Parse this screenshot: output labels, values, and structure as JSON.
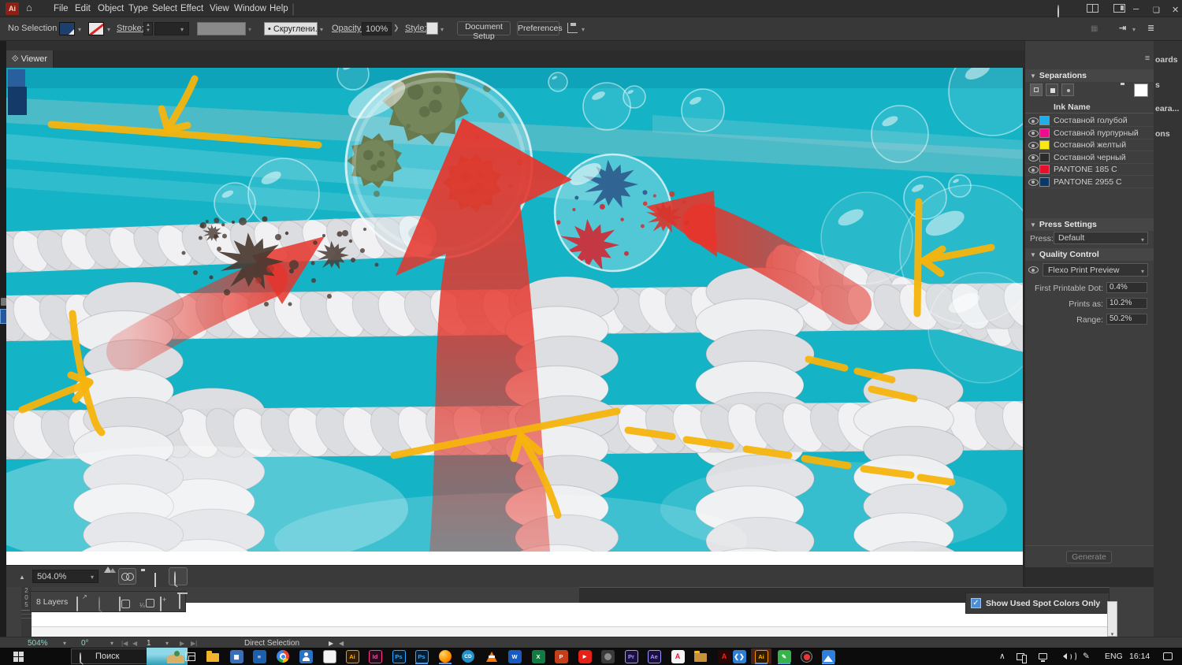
{
  "menubar": {
    "items": [
      "File",
      "Edit",
      "Object",
      "Type",
      "Select",
      "Effect",
      "View",
      "Window",
      "Help"
    ]
  },
  "controlbar": {
    "selection_status": "No Selection",
    "stroke_label": "Stroke:",
    "brush_value": "Скруглени...",
    "opacity_label": "Opacity:",
    "opacity_value": "100%",
    "style_label": "Style:",
    "document_setup_label": "Document Setup",
    "preferences_label": "Preferences"
  },
  "viewer_tab": {
    "label": "Viewer"
  },
  "separations": {
    "title": "Separations",
    "ink_name_header": "Ink Name",
    "inks": [
      {
        "name": "Составной голубой",
        "color": "#1FAEE9"
      },
      {
        "name": "Составной пурпурный",
        "color": "#EC0C8D"
      },
      {
        "name": "Составной желтый",
        "color": "#F9E814"
      },
      {
        "name": "Составной черный",
        "color": "#2D2A2B"
      },
      {
        "name": "PANTONE 185 C",
        "color": "#E8112D"
      },
      {
        "name": "PANTONE 2955 C",
        "color": "#0C3866"
      }
    ]
  },
  "press": {
    "title": "Press Settings",
    "label": "Press:",
    "value": "Default"
  },
  "quality": {
    "title": "Quality Control",
    "preview_mode": "Flexo Print Preview",
    "first_dot_label": "First Printable Dot:",
    "first_dot_value": "0.4%",
    "prints_as_label": "Prints as:",
    "prints_as_value": "10.2%",
    "range_label": "Range:",
    "range_value": "50.2%"
  },
  "generate": {
    "label": "Generate"
  },
  "spot_panel": {
    "label": "Show Used Spot Colors Only",
    "checked": true
  },
  "viewer_toolbar": {
    "zoom_value": "504.0%"
  },
  "layers_bar": {
    "label": "8 Layers"
  },
  "ruler": {
    "digits": [
      "2",
      "0",
      "5"
    ]
  },
  "status_bar": {
    "zoom": "504%",
    "rotation": "0°",
    "artboard_number": "1",
    "tool_name": "Direct Selection"
  },
  "dock_tabs": [
    "oards",
    "s",
    "eara...",
    "ons"
  ],
  "taskbar": {
    "search_text": "Поиск",
    "language": "ENG",
    "time": "16:14",
    "icons": [
      "start",
      "search",
      "weather-widget",
      "task-view",
      "file-explorer",
      "calculator",
      "journal",
      "chrome",
      "contacts",
      "notepad",
      "illustrator",
      "indesign",
      "photoshop",
      "photoshop-2",
      "firefox",
      "coreldraw",
      "vlc",
      "word",
      "excel",
      "powerpoint",
      "youtube",
      "utility",
      "premiere",
      "after-effects",
      "acrobat",
      "folder",
      "acrobat-reader",
      "ebook",
      "illustrator-active",
      "notes",
      "screen-recorder",
      "photos"
    ],
    "tray_icons": [
      "tray-expand",
      "phone-link",
      "network",
      "volume",
      "pen",
      "language",
      "clock",
      "notifications"
    ]
  },
  "artwork": {
    "colors": {
      "canvas_teal": "#14b3c6",
      "rope_white": "#e8e9eb",
      "arrow_red": "#e6352b",
      "annotation_yellow": "#f6b40d",
      "virus_green": "#6a7a4f",
      "splat_blue": "#2e5f8f",
      "splat_red": "#c9303a",
      "splatter_brown": "#4a3a31"
    }
  }
}
